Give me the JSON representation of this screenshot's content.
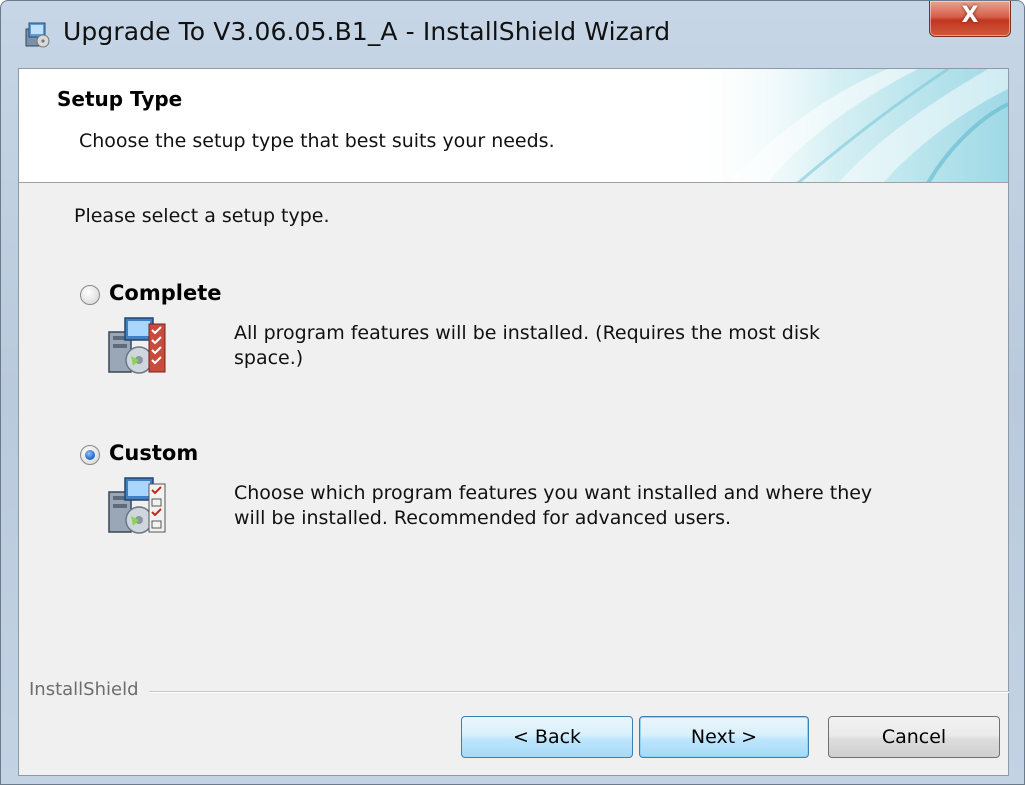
{
  "window": {
    "title": "Upgrade To V3.06.05.B1_A - InstallShield Wizard",
    "close_label": "X"
  },
  "header": {
    "title": "Setup Type",
    "subtitle": "Choose the setup type that best suits your needs."
  },
  "main": {
    "prompt": "Please select a setup type.",
    "options": [
      {
        "label": "Complete",
        "selected": false,
        "description": "All program features will be installed. (Requires the most disk space.)",
        "icon": "complete-setup-icon"
      },
      {
        "label": "Custom",
        "selected": true,
        "description": "Choose which program features you want installed and where they will be installed. Recommended for advanced users.",
        "icon": "custom-setup-icon"
      }
    ]
  },
  "footer": {
    "brand": "InstallShield",
    "buttons": {
      "back": "< Back",
      "next": "Next >",
      "cancel": "Cancel"
    }
  },
  "colors": {
    "accent": "#3c7fb1",
    "selected_radio": "#2a6fd0",
    "close_button": "#c2361f"
  }
}
